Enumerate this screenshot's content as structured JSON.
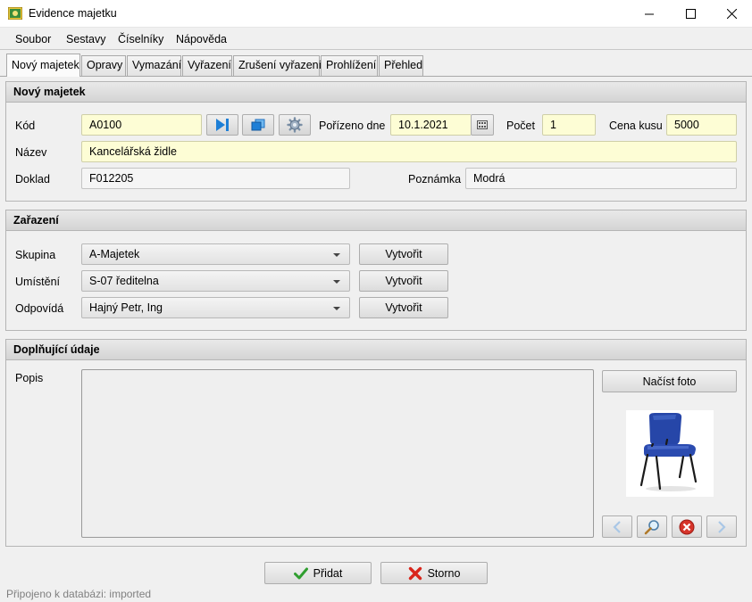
{
  "window": {
    "title": "Evidence majetku"
  },
  "menu": [
    "Soubor",
    "Sestavy",
    "Číselníky",
    "Nápověda"
  ],
  "tabs": [
    "Nový majetek",
    "Opravy",
    "Vymazání",
    "Vyřazení",
    "Zrušení vyřazení",
    "Prohlížení",
    "Přehled"
  ],
  "new_asset": {
    "header": "Nový majetek",
    "kod_label": "Kód",
    "kod_value": "A0100",
    "porizeno_label": "Pořízeno dne",
    "porizeno_value": "10.1.2021",
    "pocet_label": "Počet",
    "pocet_value": "1",
    "cena_label": "Cena kusu",
    "cena_value": "5000",
    "nazev_label": "Název",
    "nazev_value": "Kancelářská židle",
    "doklad_label": "Doklad",
    "doklad_value": "F012205",
    "poznamka_label": "Poznámka",
    "poznamka_value": "Modrá"
  },
  "classification": {
    "header": "Zařazení",
    "skupina_label": "Skupina",
    "skupina_value": "A-Majetek",
    "umisteni_label": "Umístění",
    "umisteni_value": "S-07 ředitelna",
    "odpovida_label": "Odpovídá",
    "odpovida_value": "Hajný Petr, Ing",
    "create_label": "Vytvořit"
  },
  "additional": {
    "header": "Doplňující údaje",
    "popis_label": "Popis",
    "popis_value": "",
    "load_photo_label": "Načíst foto"
  },
  "actions": {
    "add_label": "Přidat",
    "cancel_label": "Storno"
  },
  "status": "Připojeno k databázi: imported",
  "colors": {
    "required_field": "#fdfdd5",
    "accent_blue": "#1e7fd6",
    "chair_blue": "#2646a8"
  }
}
